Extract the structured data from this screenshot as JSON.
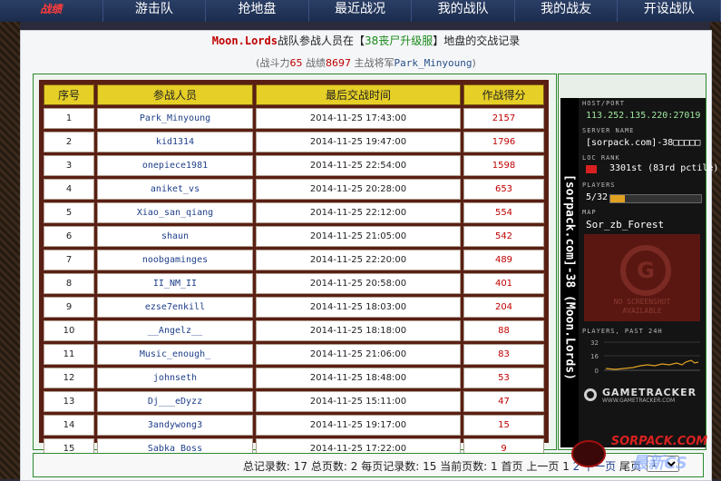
{
  "nav": {
    "items": [
      "战绩",
      "游击队",
      "抢地盘",
      "最近战况",
      "我的战队",
      "我的战友",
      "开设战队"
    ]
  },
  "header": {
    "team": "Moon.Lords",
    "text1": "战队参战人员在【",
    "server": "38丧尸升级服",
    "text2": "】地盘的交战记录"
  },
  "stats": {
    "p1": "(战斗力",
    "power": "65",
    "p2": " 战绩",
    "record": "8697",
    "p3": " 主战将军",
    "general": "Park_Minyoung",
    "p4": ")"
  },
  "table": {
    "headers": [
      "序号",
      "参战人员",
      "最后交战时间",
      "作战得分"
    ],
    "rows": [
      [
        "1",
        "Park_Minyoung",
        "2014-11-25 17:43:00",
        "2157"
      ],
      [
        "2",
        "kid1314",
        "2014-11-25 19:47:00",
        "1796"
      ],
      [
        "3",
        "onepiece1981",
        "2014-11-25 22:54:00",
        "1598"
      ],
      [
        "4",
        "aniket_vs",
        "2014-11-25 20:28:00",
        "653"
      ],
      [
        "5",
        "Xiao_san_qiang",
        "2014-11-25 22:12:00",
        "554"
      ],
      [
        "6",
        "shaun",
        "2014-11-25 21:05:00",
        "542"
      ],
      [
        "7",
        "noobgaminges",
        "2014-11-25 22:20:00",
        "489"
      ],
      [
        "8",
        "II_NM_II",
        "2014-11-25 20:58:00",
        "401"
      ],
      [
        "9",
        "ezse7enkill",
        "2014-11-25 18:03:00",
        "204"
      ],
      [
        "10",
        "__Angelz__",
        "2014-11-25 18:18:00",
        "88"
      ],
      [
        "11",
        "Music_enough_",
        "2014-11-25 21:06:00",
        "83"
      ],
      [
        "12",
        "johnseth",
        "2014-11-25 18:48:00",
        "53"
      ],
      [
        "13",
        "Dj___eDyzz",
        "2014-11-25 15:11:00",
        "47"
      ],
      [
        "14",
        "3andywong3",
        "2014-11-25 19:17:00",
        "15"
      ],
      [
        "15",
        "Sabka_Boss",
        "2014-11-25 17:22:00",
        "9"
      ]
    ]
  },
  "gametracker": {
    "vertical": "[sorpack.com]-38 (Moon.Lords)",
    "host_label": "HOST/PORT",
    "host": "113.252.135.220:27019",
    "server_label": "SERVER NAME",
    "server": "[sorpack.com]-38□□□□□",
    "loc_label": "LOC RANK",
    "rank": "3301st (83rd pctile)",
    "players_label": "PLAYERS",
    "players": "5/32",
    "players_fill": 0.16,
    "map_label": "MAP",
    "map": "Sor_zb_Forest",
    "noimg1": "NO SCREENSHOT",
    "noimg2": "AVAILABLE",
    "past_label": "PLAYERS, PAST 24H",
    "y_ticks": [
      "32",
      "16",
      "0"
    ],
    "logo": "GAMETRACKER",
    "logo_sub": "WWW.GAMETRACKER.COM"
  },
  "pager": {
    "total_label": "总记录数:",
    "total": "17",
    "pages_label": "总页数:",
    "pages": "2",
    "per_label": "每页记录数:",
    "per": "15",
    "cur_label": "当前页数:",
    "cur": "1",
    "first": "首页",
    "prev": "上一页",
    "p1": "1",
    "p2": "2",
    "next": "下一页",
    "last": "尾页",
    "select_value": "1"
  },
  "watermark": {
    "line1": "SORPACK.COM",
    "line2": "最新CS"
  }
}
